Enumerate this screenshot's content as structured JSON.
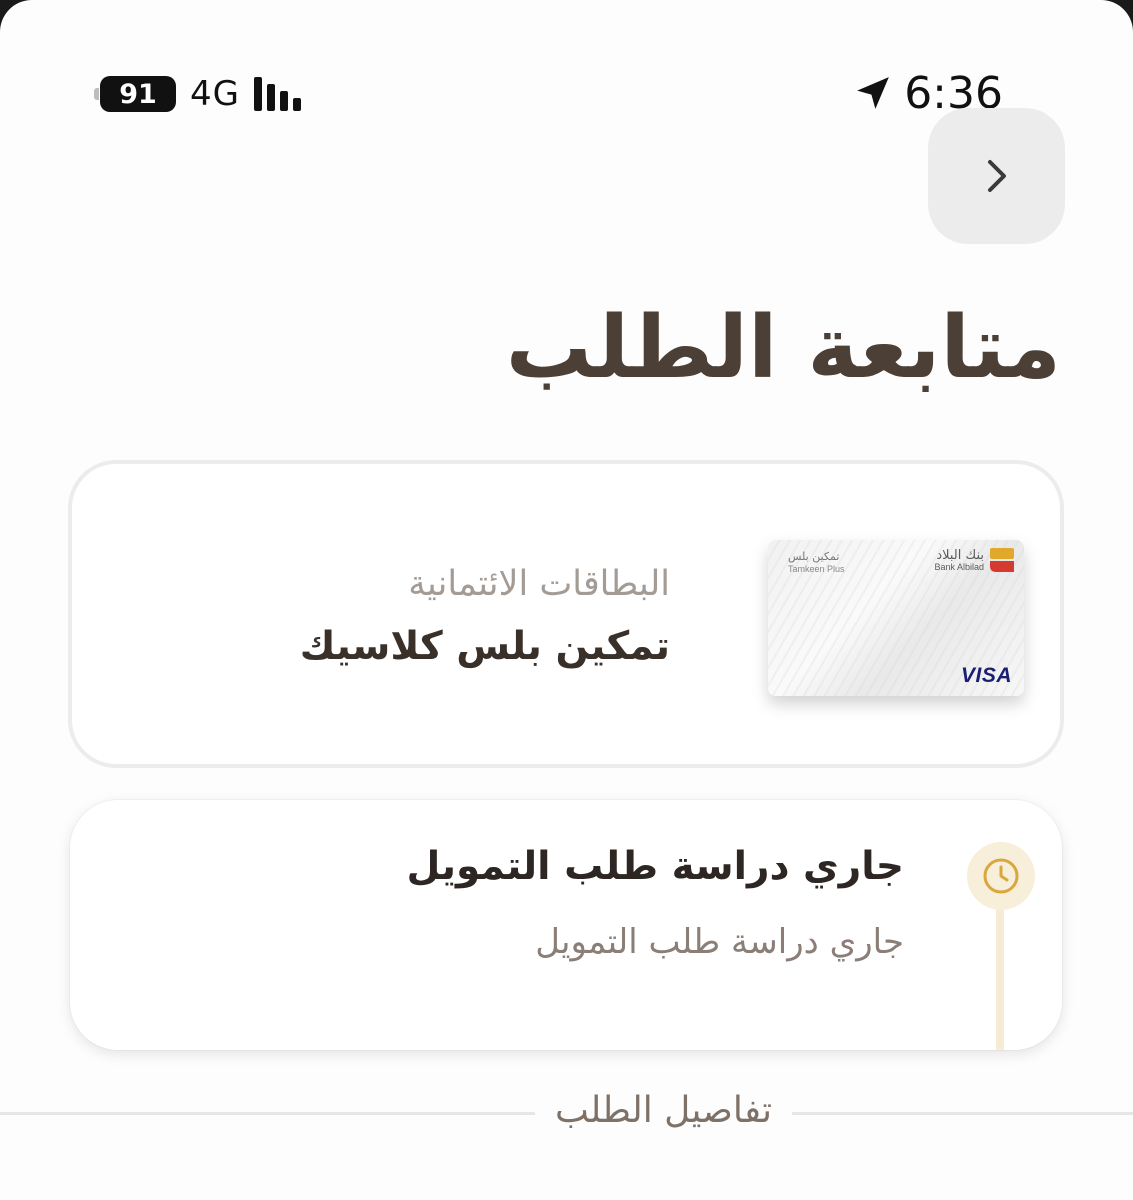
{
  "status_bar": {
    "battery": "91",
    "network": "4G",
    "time": "6:36"
  },
  "header": {
    "back_icon": "chevron-right-icon",
    "title": "متابعة الطلب"
  },
  "product": {
    "category": "البطاقات الائتمانية",
    "name": "تمكين بلس كلاسيك",
    "card_image": {
      "bank_name_ar": "بنك البلاد",
      "bank_name_en": "Bank Albilad",
      "product_ar": "تمكين بلس",
      "product_en": "Tamkeen Plus",
      "network": "VISA"
    }
  },
  "request_status": {
    "icon": "clock-icon",
    "title": "جاري دراسة طلب التمويل",
    "description": "جاري دراسة طلب التمويل"
  },
  "details_section": {
    "label": "تفاصيل الطلب"
  },
  "colors": {
    "title": "#4b3f36",
    "accent_gold": "#d9a73e",
    "timeline_bg": "#f8efda",
    "bank_logo_gold": "#e0a92b",
    "bank_logo_red": "#d43a2f",
    "visa_blue": "#1a1f71"
  }
}
